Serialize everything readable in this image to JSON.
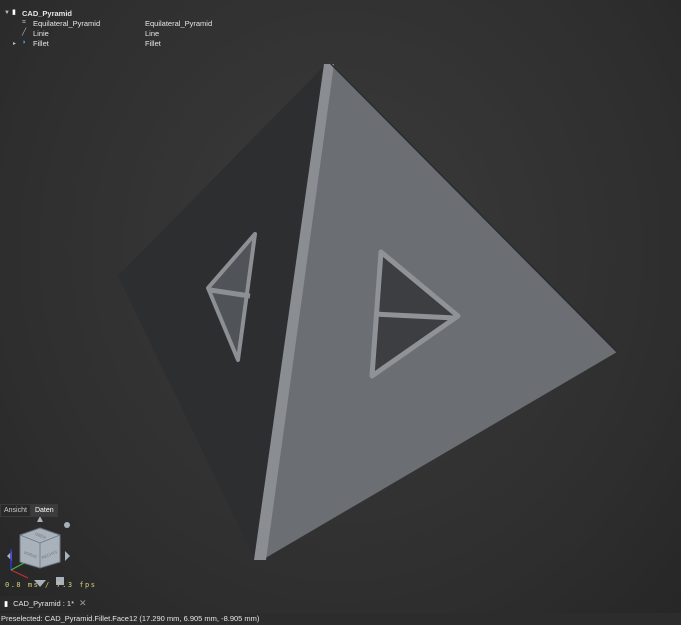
{
  "tree": {
    "root": {
      "label": "CAD_Pyramid",
      "icon": "document-icon"
    },
    "items": [
      {
        "name": "Equilateral_Pyramid",
        "value": "Equilateral_Pyramid",
        "icon": "sketch-icon"
      },
      {
        "name": "Linie",
        "value": "Line",
        "icon": "line-icon"
      },
      {
        "name": "Fillet",
        "value": "Fillet",
        "icon": "fillet-icon"
      }
    ]
  },
  "panel_tabs": [
    "Ansicht",
    "Daten"
  ],
  "nav_cube": {
    "faces": [
      "OBEN",
      "VORNE",
      "RECHTS"
    ]
  },
  "fps": "0.8 ms / 7.3 fps",
  "document_tab": {
    "label": "CAD_Pyramid : 1*"
  },
  "status": "Preselected: CAD_Pyramid.Fillet.Face12 (17.290 mm, 6.905 mm, -8.905 mm)",
  "colors": {
    "left_face": "#2d2e30",
    "right_face": "#6a6d72",
    "edge": "#8a8d92"
  }
}
